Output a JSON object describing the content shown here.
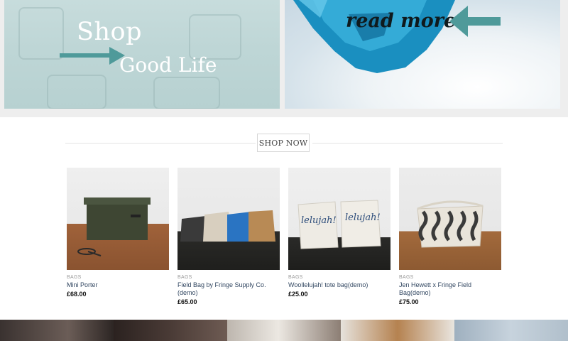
{
  "banners": {
    "left": {
      "line1": "Shop",
      "line2": "Good Life",
      "accent": "#4f9a9a"
    },
    "right": {
      "text": "read more",
      "accent": "#4f9a9a"
    }
  },
  "section": {
    "heading": "SHOP NOW"
  },
  "products": [
    {
      "category": "BAGS",
      "name": "Mini Porter",
      "price": "£68.00"
    },
    {
      "category": "BAGS",
      "name": "Field Bag by Fringe Supply Co.(demo)",
      "price": "£65.00"
    },
    {
      "category": "BAGS",
      "name": "Woollelujah! tote bag(demo)",
      "price": "£25.00"
    },
    {
      "category": "BAGS",
      "name": "Jen Hewett x Fringe Field Bag(demo)",
      "price": "£75.00"
    }
  ],
  "colors": {
    "link": "#334862",
    "category": "#9a9a9a",
    "border": "#d6d6d6"
  }
}
